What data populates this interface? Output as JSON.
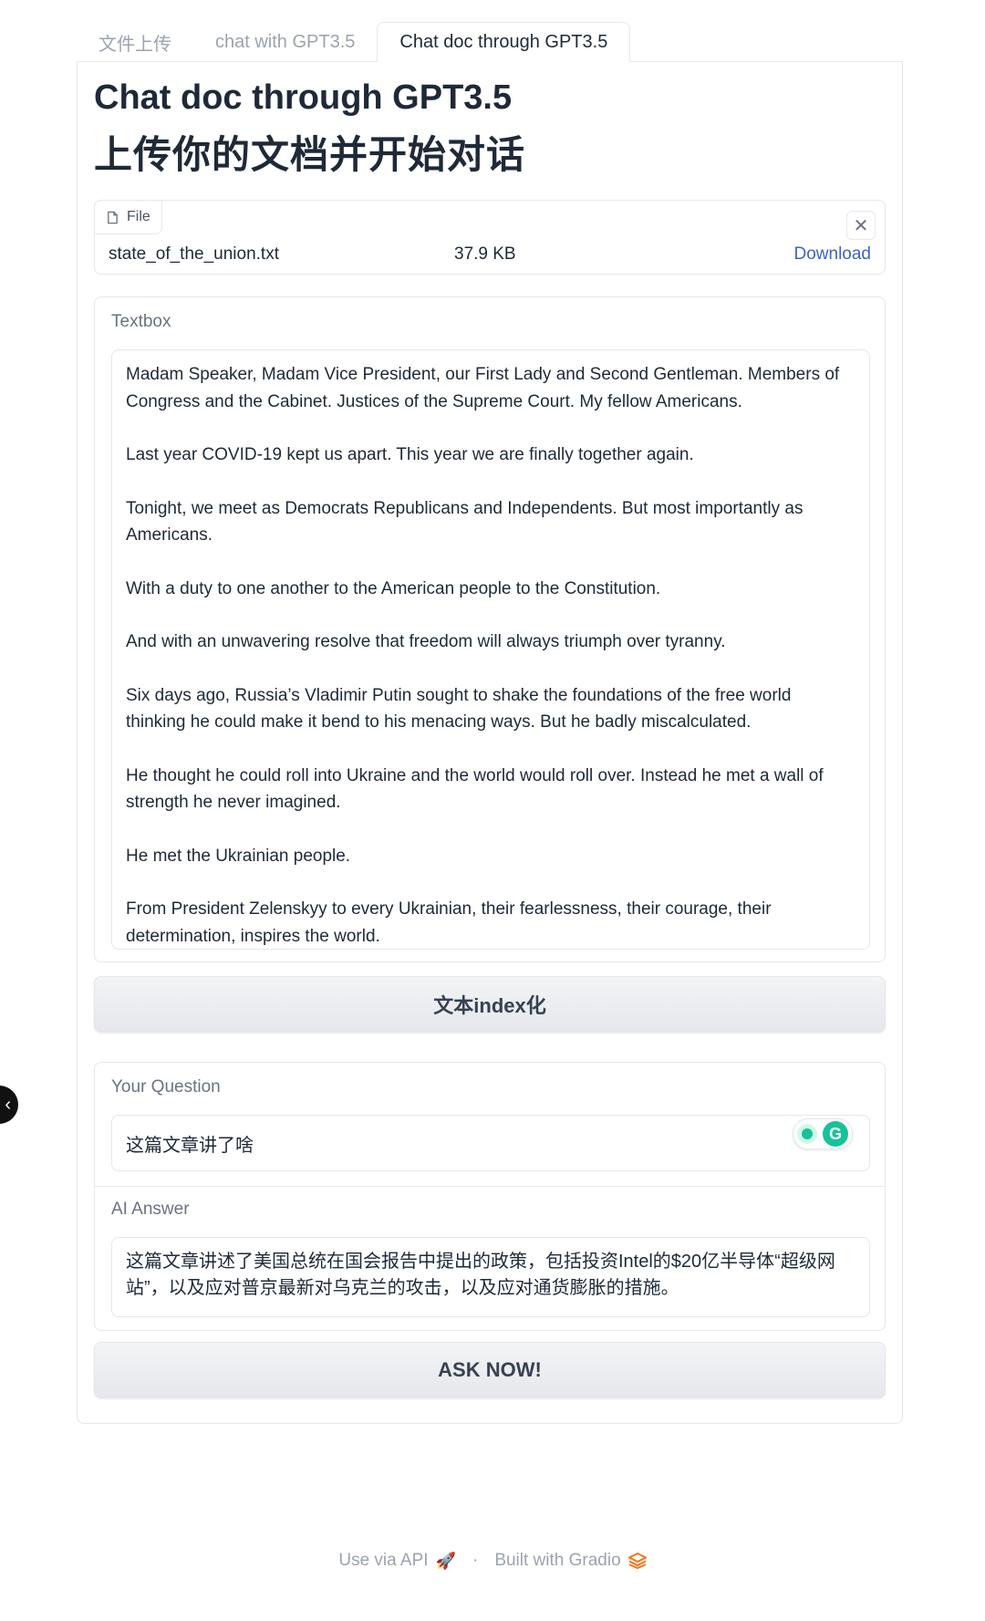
{
  "tabs": [
    {
      "label": "文件上传",
      "active": false
    },
    {
      "label": "chat with GPT3.5",
      "active": false
    },
    {
      "label": "Chat doc through GPT3.5",
      "active": true
    }
  ],
  "page": {
    "title": "Chat doc through GPT3.5",
    "subtitle": "上传你的文档并开始对话"
  },
  "file": {
    "label": "File",
    "name": "state_of_the_union.txt",
    "size": "37.9 KB",
    "download_label": "Download"
  },
  "textbox": {
    "label": "Textbox",
    "paragraphs": [
      "Madam Speaker, Madam Vice President, our First Lady and Second Gentleman. Members of Congress and the Cabinet. Justices of the Supreme Court. My fellow Americans.",
      "Last year COVID-19 kept us apart. This year we are finally together again.",
      "Tonight, we meet as Democrats Republicans and Independents. But most importantly as Americans.",
      "With a duty to one another to the American people to the Constitution.",
      "And with an unwavering resolve that freedom will always triumph over tyranny.",
      "Six days ago, Russia’s Vladimir Putin sought to shake the foundations of the free world thinking he could make it bend to his menacing ways. But he badly miscalculated.",
      "He thought he could roll into Ukraine and the world would roll over. Instead he met a wall of strength he never imagined.",
      "He met the Ukrainian people.",
      "From President Zelenskyy to every Ukrainian, their fearlessness, their courage, their determination, inspires the world."
    ]
  },
  "index_button": {
    "label": "文本index化"
  },
  "question": {
    "label": "Your Question",
    "value": "这篇文章讲了啥"
  },
  "answer": {
    "label": "AI Answer",
    "value": " 这篇文章讲述了美国总统在国会报告中提出的政策，包括投资Intel的$20亿半导体“超级网站”，以及应对普京最新对乌克兰的攻击，以及应对通货膨胀的措施。"
  },
  "ask_button": {
    "label": "ASK NOW!"
  },
  "footer": {
    "api_label": "Use via API",
    "separator": "·",
    "built_label": "Built with Gradio"
  },
  "colors": {
    "link": "#3b63c8",
    "grammarly": "#15c39a",
    "accent": "#f97316"
  }
}
